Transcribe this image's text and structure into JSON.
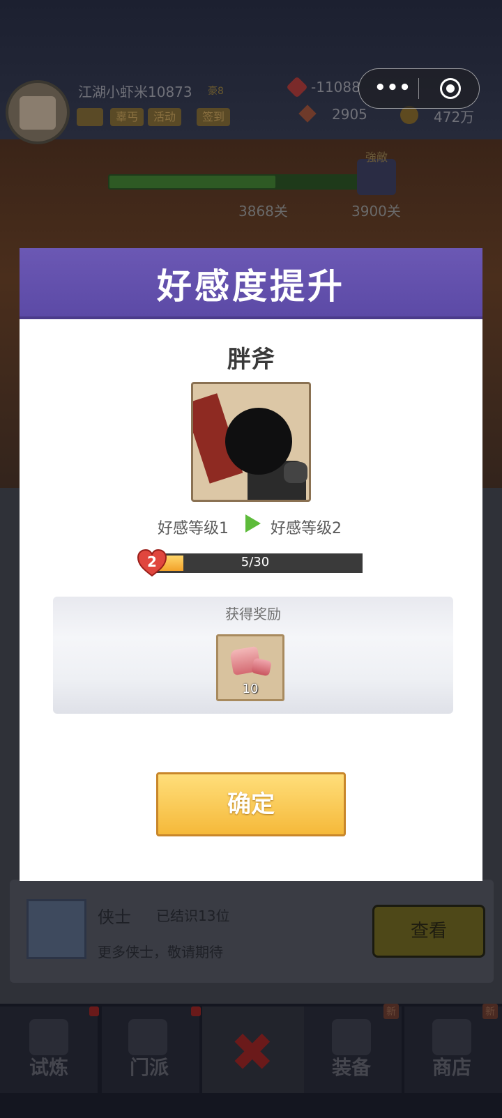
{
  "top_bar": {
    "player_name": "江湖小虾米10873",
    "rank": "豪8",
    "tags": [
      "",
      "辜丐",
      "活动",
      "签到"
    ],
    "resources": {
      "gem": "-11088",
      "diamond": "2905",
      "coin": "472万"
    }
  },
  "stage": {
    "current": "3868关",
    "boss_label": "強敵",
    "boss_stage": "3900关"
  },
  "miniprogram": {
    "dots": "•••"
  },
  "dialog": {
    "title": "好感度提升",
    "npc_name": "胖斧",
    "level_from": "好感等级1",
    "level_to": "好感等级2",
    "heart_level": "2",
    "progress_text": "5/30",
    "progress_value": 5,
    "progress_max": 30,
    "reward_title": "获得奖励",
    "reward_qty": "10",
    "confirm_label": "确定"
  },
  "hero_panel": {
    "title": "侠士",
    "count": "已结识13位",
    "subtitle": "更多侠士，敬请期待",
    "view_label": "查看"
  },
  "bottom_nav": {
    "tabs": [
      {
        "label": "试炼",
        "badge": ""
      },
      {
        "label": "门派",
        "badge": ""
      },
      {
        "label": "装备",
        "badge": "新"
      },
      {
        "label": "商店",
        "badge": "新"
      }
    ],
    "close_symbol": "✖"
  },
  "colors": {
    "header_purple": "#6b58b4",
    "confirm_yellow": "#f5b93a",
    "arrow_green": "#5dbb3a",
    "heart_red": "#e0463e"
  }
}
